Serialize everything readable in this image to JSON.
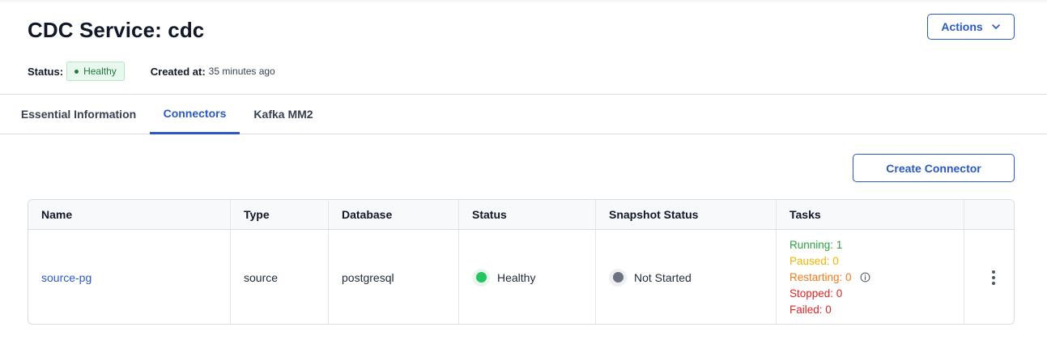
{
  "header": {
    "title": "CDC Service: cdc",
    "actions_label": "Actions",
    "status_label": "Status:",
    "status_value": "Healthy",
    "created_label": "Created at:",
    "created_value": "35 minutes ago"
  },
  "tabs": [
    {
      "label": "Essential Information",
      "active": false
    },
    {
      "label": "Connectors",
      "active": true
    },
    {
      "label": "Kafka MM2",
      "active": false
    }
  ],
  "toolbar": {
    "create_label": "Create Connector"
  },
  "table": {
    "columns": [
      "Name",
      "Type",
      "Database",
      "Status",
      "Snapshot Status",
      "Tasks",
      ""
    ],
    "rows": [
      {
        "name": "source-pg",
        "type": "source",
        "database": "postgresql",
        "status": "Healthy",
        "snapshot_status": "Not Started",
        "tasks": {
          "running": "Running: 1",
          "paused": "Paused: 0",
          "restarting": "Restarting: 0",
          "stopped": "Stopped: 0",
          "failed": "Failed: 0"
        }
      }
    ]
  },
  "colors": {
    "accent": "#2b59c3",
    "healthy": "#22c55e",
    "not_started": "#6b7280",
    "running": "#2ea043",
    "paused": "#f0b400",
    "restarting": "#f07a1a",
    "stopped": "#e02424",
    "failed": "#e02424"
  },
  "icons": {
    "actions": "chevron-down-icon",
    "restarting_info": "info-icon",
    "row_menu": "kebab-menu-icon"
  }
}
